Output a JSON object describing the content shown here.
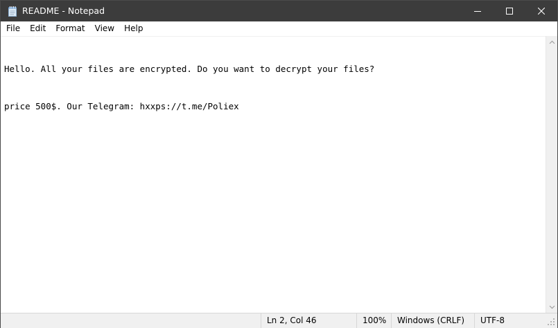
{
  "window": {
    "title": "README - Notepad",
    "icon": "notepad-icon",
    "controls": [
      "minimize-icon",
      "maximize-icon",
      "close-icon"
    ],
    "titlebar_color": "#3c3c3c"
  },
  "menu": {
    "items": [
      {
        "label": "File"
      },
      {
        "label": "Edit"
      },
      {
        "label": "Format"
      },
      {
        "label": "View"
      },
      {
        "label": "Help"
      }
    ]
  },
  "editor": {
    "lines": [
      "Hello. All your files are encrypted. Do you want to decrypt your files?",
      "price 500$. Our Telegram: hxxps://t.me/Poliex"
    ]
  },
  "status": {
    "position": "Ln 2, Col 46",
    "zoom": "100%",
    "line_ending": "Windows (CRLF)",
    "encoding": "UTF-8"
  }
}
